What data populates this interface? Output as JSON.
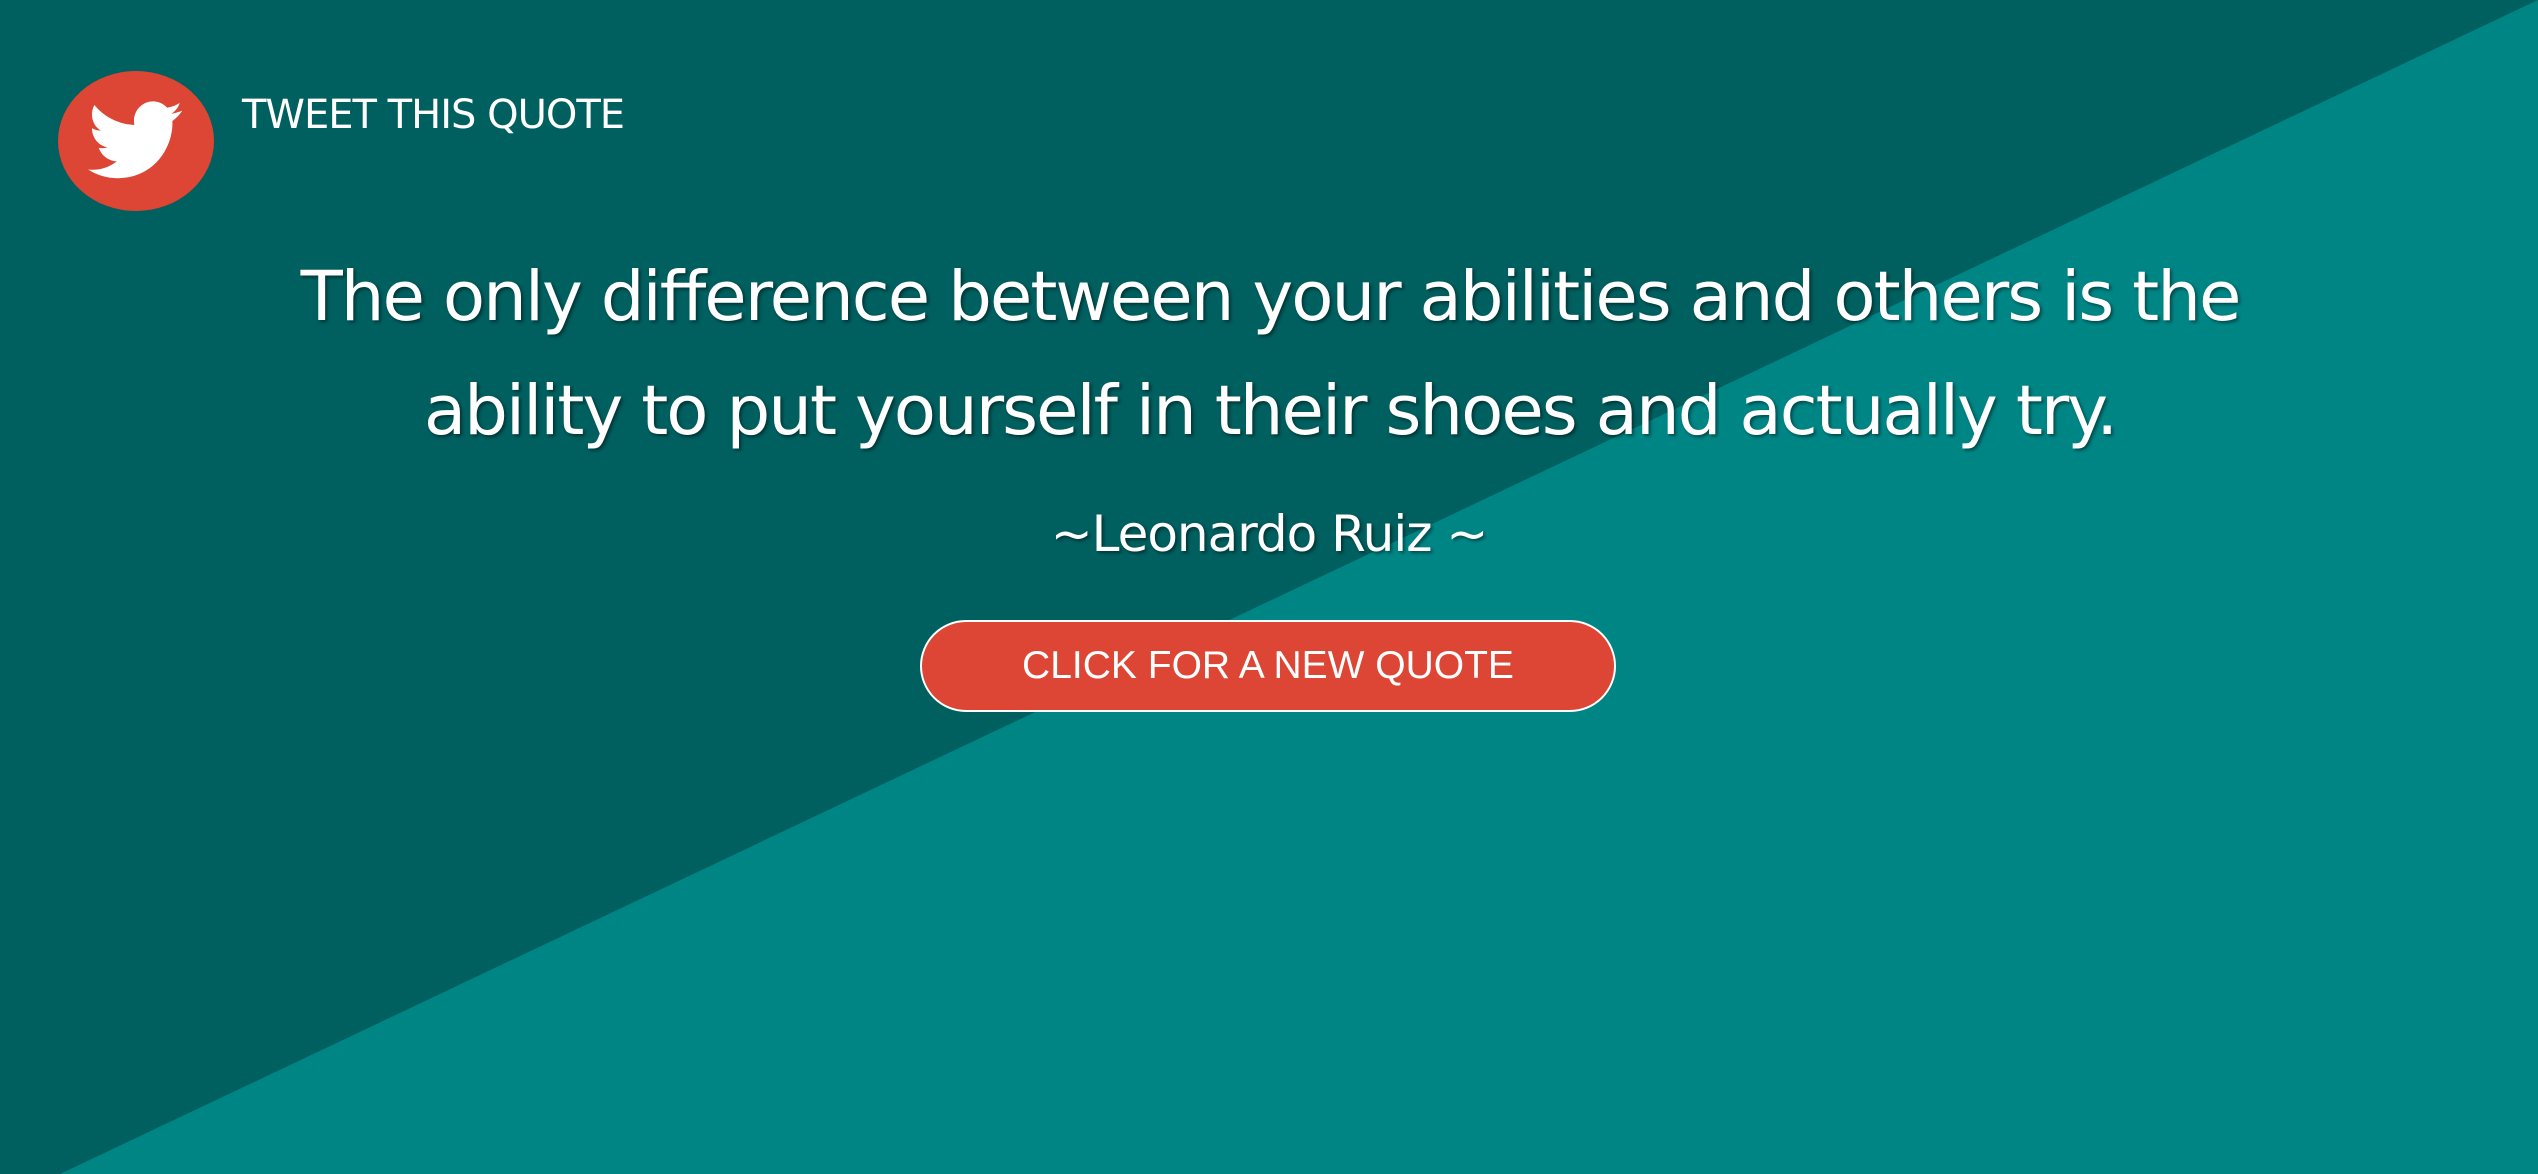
{
  "colors": {
    "background_dark": "#005f5f",
    "background_light": "#008585",
    "accent_red": "#dd4634",
    "text": "#ffffff"
  },
  "header": {
    "tweet_icon": "twitter-bird-icon",
    "tweet_label": "TWEET THIS QUOTE"
  },
  "quote": {
    "text": "The only difference between your abilities and others is the ability to put yourself in their shoes and actually try.",
    "author": "~Leonardo Ruiz ~"
  },
  "actions": {
    "new_quote_label": "CLICK FOR A NEW QUOTE"
  }
}
